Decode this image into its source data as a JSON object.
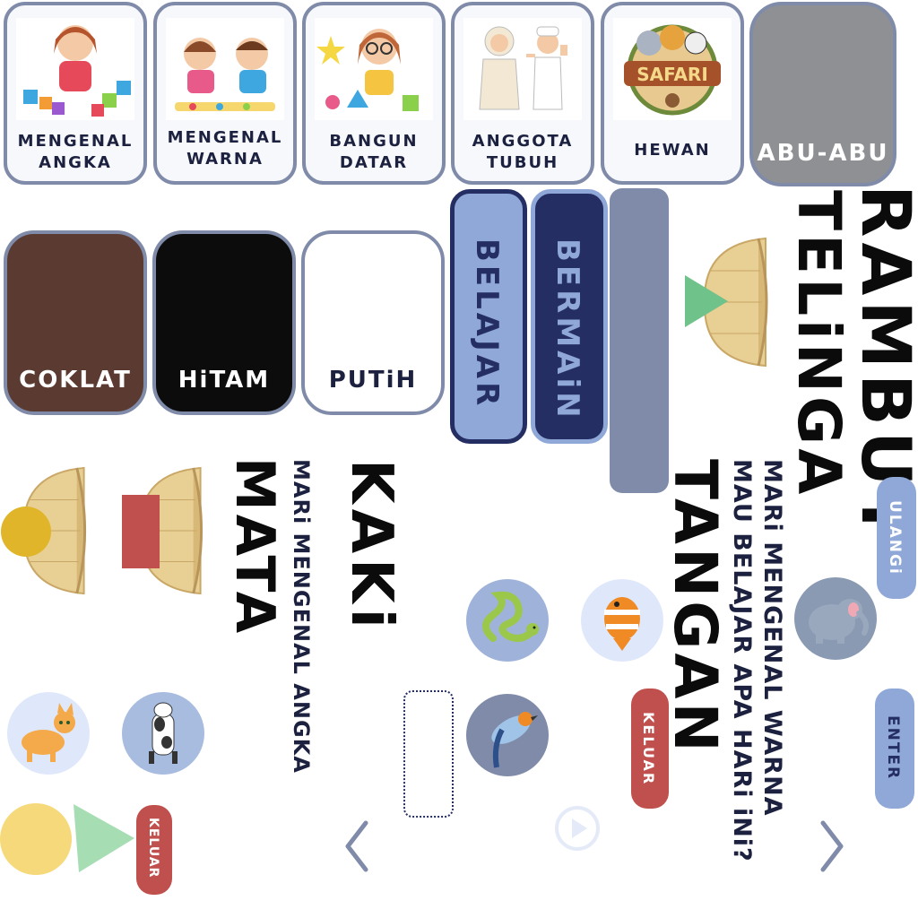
{
  "menu": {
    "cards": [
      {
        "label_line1": "MENGENAL",
        "label_line2": "ANGKA"
      },
      {
        "label_line1": "MENGENAL",
        "label_line2": "WARNA"
      },
      {
        "label_line1": "BANGUN",
        "label_line2": "DATAR"
      },
      {
        "label_line1": "ANGGOTA",
        "label_line2": "TUBUH"
      },
      {
        "label_line1": "HEWAN",
        "label_line2": ""
      }
    ],
    "safari_logo_text": "SAFARI",
    "gray_card_label": "ABU-ABU"
  },
  "colors": {
    "swatches": [
      {
        "label": "COKLAT",
        "bg": "#5b3a32",
        "fg": "#ffffff"
      },
      {
        "label": "HiTAM",
        "bg": "#0c0c0c",
        "fg": "#ffffff"
      },
      {
        "label": "PUTiH",
        "bg": "#ffffff",
        "fg": "#1c2140"
      }
    ],
    "accent_blue": "#8fa8d8",
    "navy": "#252e62",
    "slate": "#7f8ba9",
    "keluar_red": "#c0504d"
  },
  "modes": {
    "belajar": "BELAJAR",
    "bermain": "BERMAiN"
  },
  "body_parts": {
    "rambut": "RAMBUT",
    "telinga": "TELiNGA",
    "tangan": "TANGAN",
    "kaki": "KAKi",
    "mata": "MATA"
  },
  "prompts": {
    "warna": "MARi MENGENAL WARNA",
    "question": "MAU BELAJAR APA HARi iNi?",
    "angka": "MARi MENGENAL ANGKA"
  },
  "buttons": {
    "ulangi": "ULANGi",
    "enter": "ENTER",
    "keluar_1": "KELUAR",
    "keluar_2": "KELUAR"
  },
  "animals": [
    "snake",
    "clownfish",
    "elephant",
    "bird",
    "cat",
    "cow"
  ]
}
